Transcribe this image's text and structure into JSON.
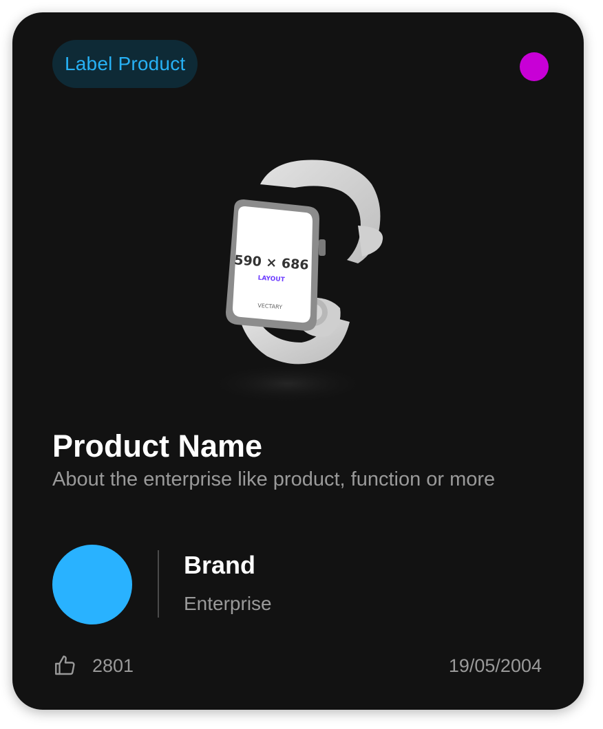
{
  "card": {
    "label": "Label Product",
    "status_color": "#c800d6",
    "image": {
      "icon": "smartwatch-image",
      "screen_size_text": "590 × 686",
      "screen_layout_text": "LAYOUT",
      "screen_brand_text": "VECTARY"
    },
    "product_name": "Product Name",
    "description": "About the enterprise like product, function or more",
    "brand": {
      "name": "Brand",
      "type": "Enterprise",
      "avatar_color": "#29b2ff"
    },
    "likes": {
      "icon": "thumbs-up-icon",
      "count": "2801"
    },
    "date": "19/05/2004"
  },
  "colors": {
    "card_background": "#121212",
    "label_text": "#27b1f5",
    "label_background": "#0e2a36"
  }
}
